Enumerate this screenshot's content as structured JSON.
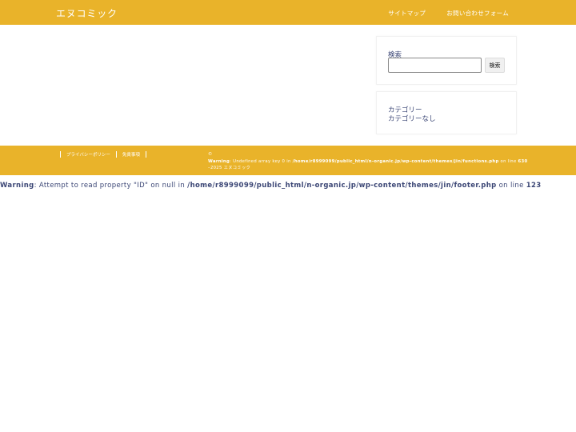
{
  "header": {
    "site_title": "エヌコミック",
    "nav": [
      "サイトマップ",
      "お問い合わせフォーム"
    ]
  },
  "sidebar": {
    "search": {
      "label": "検索",
      "input_value": "",
      "button_label": "検索"
    },
    "categories": {
      "heading": "カテゴリー",
      "empty_text": "カテゴリーなし"
    }
  },
  "footer": {
    "links": [
      "プライバシーポリシー",
      "免責事項"
    ],
    "copyright_symbol": "©",
    "warning": {
      "label": "Warning",
      "message": ": Undefined array key 0 in ",
      "path": "/home/r8999099/public_html/n-organic.jp/wp-content/themes/jin/functions.php",
      "on_line": " on line ",
      "line": "630"
    },
    "year_site": "–2025  エヌコミック"
  },
  "page_warning": {
    "label": "Warning",
    "message": ": Attempt to read property \"ID\" on null in ",
    "path": "/home/r8999099/public_html/n-organic.jp/wp-content/themes/jin/footer.php",
    "on_line": " on line ",
    "line": "123"
  },
  "colors": {
    "accent": "#e9b32a",
    "text": "#3b4675",
    "background": "#ffffff"
  }
}
